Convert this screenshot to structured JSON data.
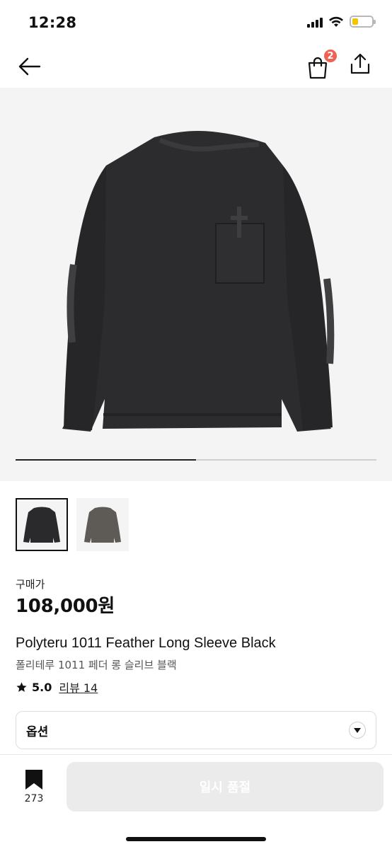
{
  "status_bar": {
    "time": "12:28",
    "signal_icon": "signal-icon",
    "wifi_icon": "wifi-icon",
    "battery_icon": "battery-icon",
    "battery_level": 0.3,
    "battery_color": "#f2c500"
  },
  "nav": {
    "back_icon": "arrow-left-icon",
    "cart_icon": "shopping-bag-icon",
    "cart_count": "2",
    "cart_badge_color": "#ef6253",
    "share_icon": "share-icon"
  },
  "gallery": {
    "progress": 0.5,
    "thumbnails": [
      {
        "color_name": "black",
        "swatch": "#2a2a2c",
        "selected": true
      },
      {
        "color_name": "grey",
        "swatch": "#5e5a55",
        "selected": false
      }
    ]
  },
  "product": {
    "price_label": "구매가",
    "price": "108,000원",
    "name_en": "Polyteru 1011 Feather Long Sleeve Black",
    "name_ko": "폴리테루 1011 페더 롱 슬리브 블랙",
    "rating": "5.0",
    "review_text": "리뷰 14"
  },
  "option": {
    "label": "옵션",
    "caret_icon": "chevron-down-icon"
  },
  "bottom_bar": {
    "bookmark_icon": "bookmark-icon",
    "bookmark_count": "273",
    "button_label": "일시 품절"
  }
}
